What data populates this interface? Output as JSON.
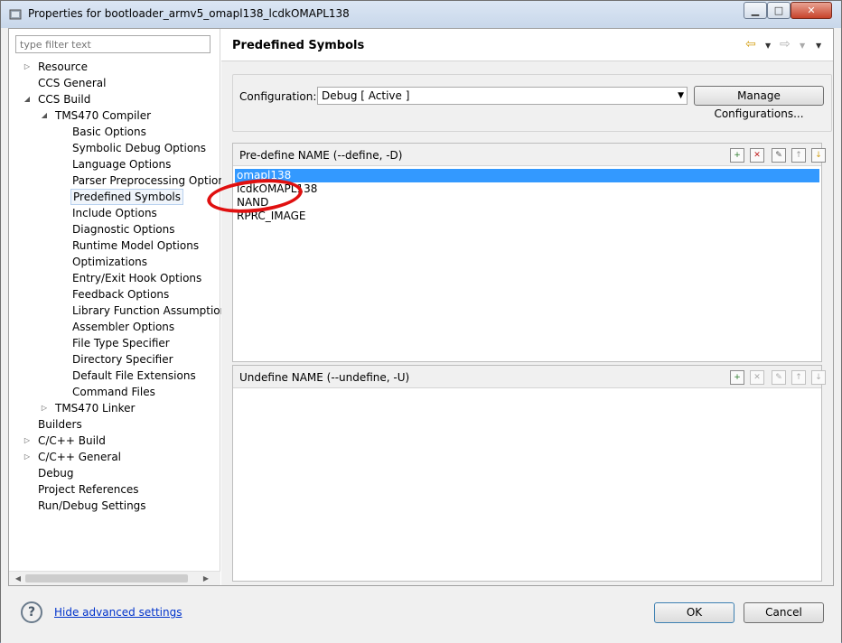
{
  "window": {
    "title": "Properties for bootloader_armv5_omapl138_lcdkOMAPL138",
    "min_glyph": "▁",
    "max_glyph": "□",
    "close_glyph": "✕"
  },
  "left": {
    "filter_placeholder": "type filter text",
    "tree": [
      {
        "label": "Resource",
        "level": 0,
        "twisty": "collapsed"
      },
      {
        "label": "CCS General",
        "level": 0,
        "twisty": "none"
      },
      {
        "label": "CCS Build",
        "level": 0,
        "twisty": "expanded"
      },
      {
        "label": "TMS470 Compiler",
        "level": 1,
        "twisty": "expanded"
      },
      {
        "label": "Basic Options",
        "level": 2,
        "twisty": "none"
      },
      {
        "label": "Symbolic Debug Options",
        "level": 2,
        "twisty": "none"
      },
      {
        "label": "Language Options",
        "level": 2,
        "twisty": "none"
      },
      {
        "label": "Parser Preprocessing Options",
        "level": 2,
        "twisty": "none"
      },
      {
        "label": "Predefined Symbols",
        "level": 2,
        "twisty": "none",
        "selected": true
      },
      {
        "label": "Include Options",
        "level": 2,
        "twisty": "none"
      },
      {
        "label": "Diagnostic Options",
        "level": 2,
        "twisty": "none"
      },
      {
        "label": "Runtime Model Options",
        "level": 2,
        "twisty": "none"
      },
      {
        "label": "Optimizations",
        "level": 2,
        "twisty": "none"
      },
      {
        "label": "Entry/Exit Hook Options",
        "level": 2,
        "twisty": "none"
      },
      {
        "label": "Feedback Options",
        "level": 2,
        "twisty": "none"
      },
      {
        "label": "Library Function Assumption",
        "level": 2,
        "twisty": "none"
      },
      {
        "label": "Assembler Options",
        "level": 2,
        "twisty": "none"
      },
      {
        "label": "File Type Specifier",
        "level": 2,
        "twisty": "none"
      },
      {
        "label": "Directory Specifier",
        "level": 2,
        "twisty": "none"
      },
      {
        "label": "Default File Extensions",
        "level": 2,
        "twisty": "none"
      },
      {
        "label": "Command Files",
        "level": 2,
        "twisty": "none"
      },
      {
        "label": "TMS470 Linker",
        "level": 1,
        "twisty": "collapsed"
      },
      {
        "label": "Builders",
        "level": 0,
        "twisty": "none"
      },
      {
        "label": "C/C++ Build",
        "level": 0,
        "twisty": "collapsed"
      },
      {
        "label": "C/C++ General",
        "level": 0,
        "twisty": "collapsed"
      },
      {
        "label": "Debug",
        "level": 0,
        "twisty": "none"
      },
      {
        "label": "Project References",
        "level": 0,
        "twisty": "none"
      },
      {
        "label": "Run/Debug Settings",
        "level": 0,
        "twisty": "none"
      }
    ],
    "scroll_left": "◀",
    "scroll_right": "▶"
  },
  "page": {
    "title": "Predefined Symbols",
    "nav": {
      "back": "⇦",
      "forward": "⇨",
      "dropdown": "▼",
      "menu": "▼"
    },
    "config_label": "Configuration:",
    "config_value": "Debug  [ Active ]",
    "config_arrow": "▼",
    "manage_label": "Manage Configurations...",
    "predefine": {
      "title": "Pre-define NAME (--define, -D)",
      "items": [
        "omapl138",
        "lcdkOMAPL138",
        "NAND",
        "RPRC_IMAGE"
      ],
      "selected_index": 0,
      "tools": [
        "add-icon",
        "delete-icon",
        "edit-icon",
        "move-up-icon",
        "move-down-icon"
      ]
    },
    "undefine": {
      "title": "Undefine NAME (--undefine, -U)",
      "items": [],
      "tools": [
        "add-icon",
        "delete-icon",
        "edit-icon",
        "move-up-icon",
        "move-down-icon"
      ]
    },
    "tool_glyphs": {
      "add": "+",
      "delete": "✕",
      "edit": "✎",
      "up": "↑",
      "down": "↓"
    }
  },
  "footer": {
    "help_glyph": "?",
    "hide_advanced_label": "Hide advanced settings",
    "ok_label": "OK",
    "cancel_label": "Cancel"
  },
  "colors": {
    "selection": "#3399ff",
    "annotation_ring": "#e01010",
    "link": "#0033cc"
  }
}
